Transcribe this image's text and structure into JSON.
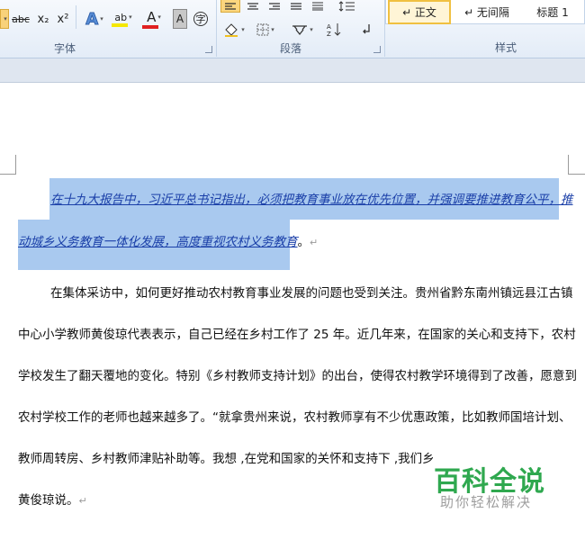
{
  "ribbon": {
    "font_group_label": "字体",
    "paragraph_group_label": "段落",
    "styles_group_label": "样式",
    "font_buttons": {
      "strikethrough": "abc",
      "subscript": "x₂",
      "superscript": "x²",
      "text_effect": "A",
      "highlight": "ab",
      "font_color": "A",
      "char_shading": "A",
      "enclose": "字"
    },
    "colors": {
      "highlight_bar": "#f5e800",
      "font_color_bar": "#e02020",
      "selected_style_border": "#f0c040"
    },
    "styles": [
      {
        "label": "↵ 正文",
        "selected": true
      },
      {
        "label": "↵ 无间隔",
        "selected": false
      },
      {
        "label": "标题 1",
        "selected": false
      }
    ]
  },
  "document": {
    "selected_line1": "在十九大报告中，习近平总书记指出，必须把教育事业放在优先位置，并强调要推进教育公平，推",
    "selected_line2": "动城乡义务教育一体化发展，高度重视农村义务教育",
    "selected_end": "。",
    "para_lines": [
      "在集体采访中，如何更好推动农村教育事业发展的问题也受到关注。贵州省黔东南州镇远县江古镇",
      "中心小学教师黄俊琼代表表示，自己已经在乡村工作了 25 年。近几年来，在国家的关心和支持下，农村",
      "学校发生了翻天覆地的变化。特别《乡村教师支持计划》的出台，使得农村教学环境得到了改善，愿意到",
      "农村学校工作的老师也越来越多了。“就拿贵州来说，农村教师享有不少优惠政策，比如教师国培计划、",
      "教师周转房、乡村教师津贴补助等。我想 ,在党和国家的关怀和支持下 ,我们乡",
      "黄俊琼说。"
    ],
    "paragraph_mark": "↵"
  },
  "watermark": {
    "title": "百科全说",
    "subtitle": "助你轻松解决"
  }
}
